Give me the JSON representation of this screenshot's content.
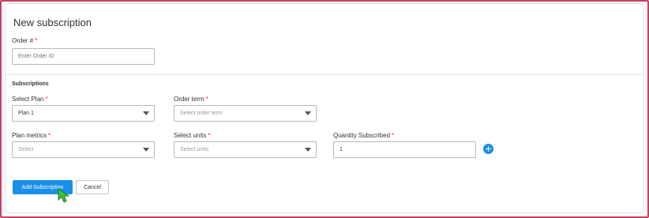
{
  "page": {
    "title": "New subscription"
  },
  "order": {
    "label": "Order #",
    "placeholder": "Enter Order ID"
  },
  "subscriptions": {
    "section_title": "Subscriptions",
    "select_plan": {
      "label": "Select Plan",
      "value": "Plan 1"
    },
    "order_term": {
      "label": "Order term",
      "placeholder": "Select order term"
    },
    "plan_metrics": {
      "label": "Plan metrics",
      "placeholder": "Select"
    },
    "select_units": {
      "label": "Select units",
      "placeholder": "Select units"
    },
    "quantity": {
      "label": "Quantity Subscribed",
      "value": "1"
    },
    "required_marker": "*"
  },
  "actions": {
    "add_label": "Add Subscription",
    "cancel_label": "Cancel"
  },
  "colors": {
    "accent": "#1a8fe8",
    "required": "#e03131",
    "frame": "#c8415f",
    "cursor": "#3cc23c"
  },
  "icons": {
    "add_row": "plus-circle-icon",
    "dropdown": "caret-down-icon",
    "pointer": "mouse-pointer-icon"
  }
}
